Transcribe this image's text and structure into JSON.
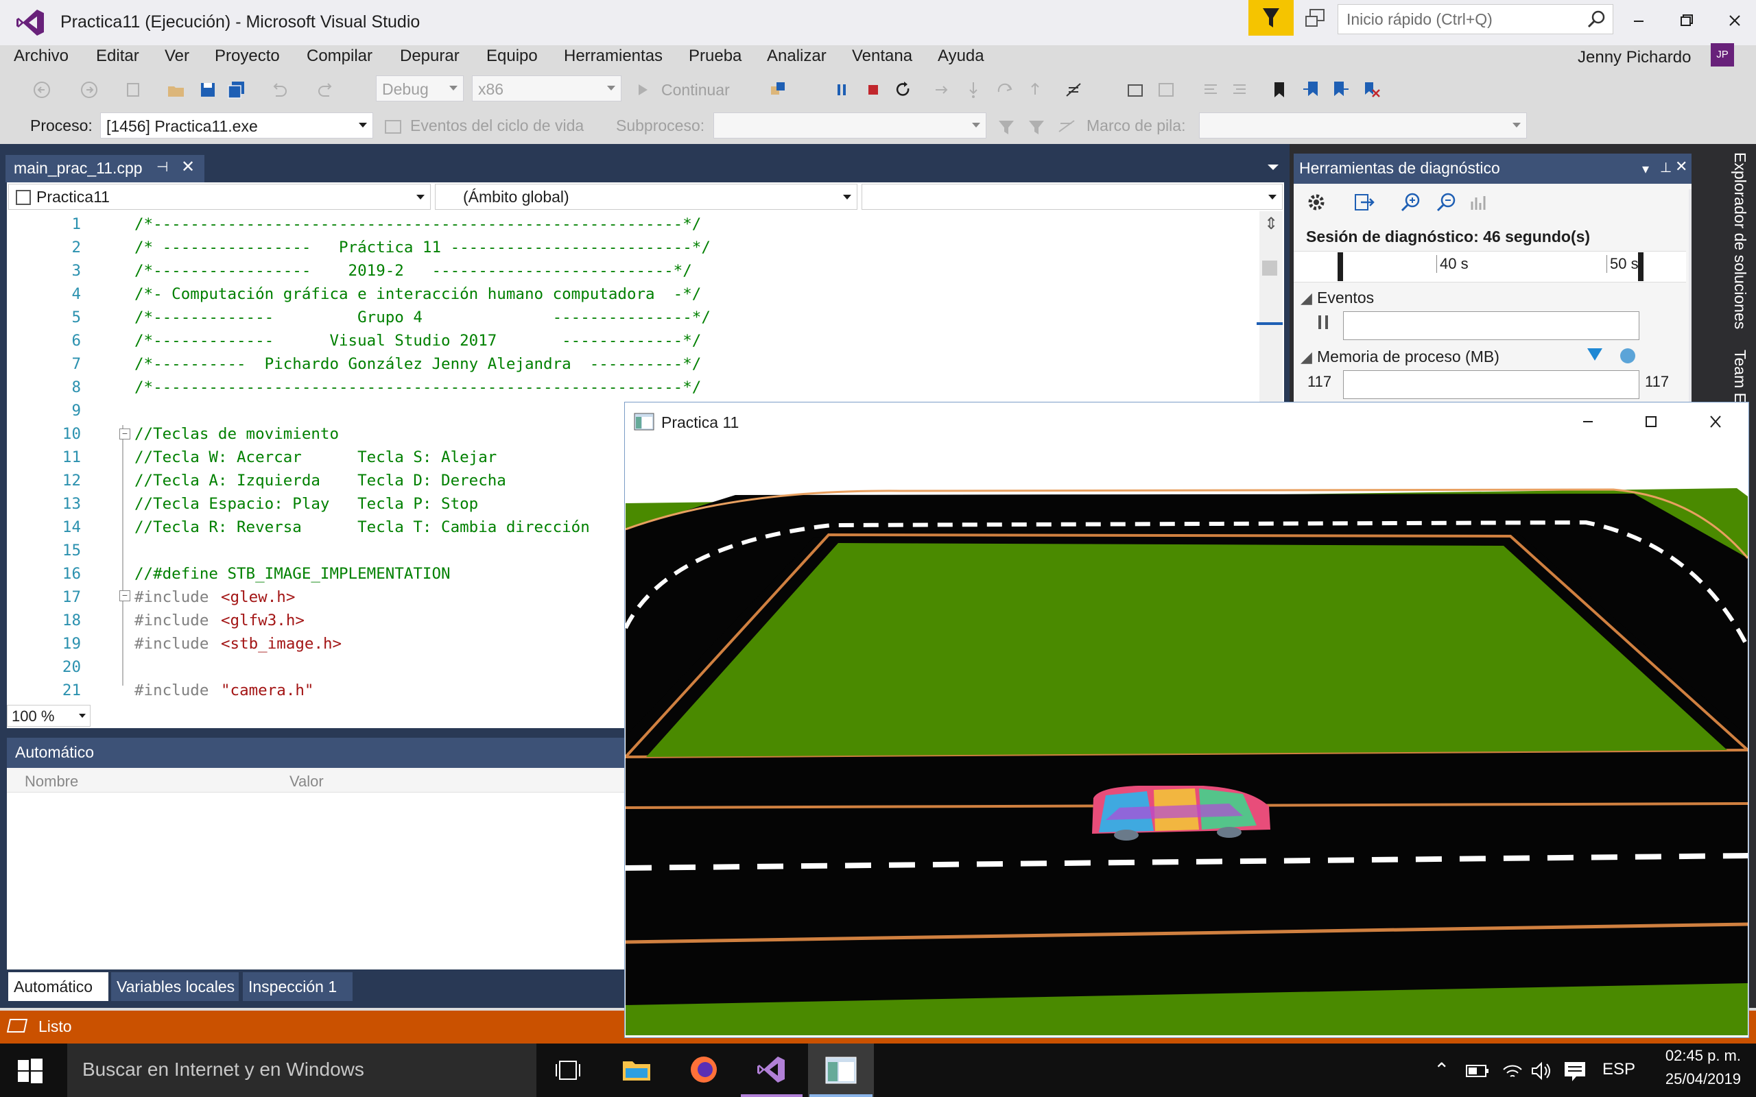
{
  "window": {
    "title": "Practica11 (Ejecución) - Microsoft Visual Studio",
    "quick_launch_placeholder": "Inicio rápido (Ctrl+Q)"
  },
  "menu": [
    "Archivo",
    "Editar",
    "Ver",
    "Proyecto",
    "Compilar",
    "Depurar",
    "Equipo",
    "Herramientas",
    "Prueba",
    "Analizar",
    "Ventana",
    "Ayuda"
  ],
  "user": {
    "name": "Jenny Pichardo",
    "initials": "JP"
  },
  "toolbar": {
    "config": "Debug",
    "platform": "x86",
    "continue": "Continuar",
    "process_label": "Proceso:",
    "process": "[1456] Practica11.exe",
    "lifecycle": "Eventos del ciclo de vida",
    "thread_label": "Subproceso:",
    "stack_label": "Marco de pila:"
  },
  "editor": {
    "tab": "main_prac_11.cpp",
    "scope_project": "Practica11",
    "scope_global": "(Ámbito global)",
    "zoom": "100 %",
    "lines": [
      {
        "n": "1",
        "t": "/*---------------------------------------------------------*/",
        "c": "cm"
      },
      {
        "n": "2",
        "t": "/* ----------------   Práctica 11 --------------------------*/",
        "c": "cm"
      },
      {
        "n": "3",
        "t": "/*-----------------    2019-2   --------------------------*/",
        "c": "cm"
      },
      {
        "n": "4",
        "t": "/*- Computación gráfica e interacción humano computadora  -*/",
        "c": "cm"
      },
      {
        "n": "5",
        "t": "/*-------------         Grupo 4              ---------------*/",
        "c": "cm"
      },
      {
        "n": "6",
        "t": "/*-------------      Visual Studio 2017       -------------*/",
        "c": "cm"
      },
      {
        "n": "7",
        "t": "/*----------  Pichardo González Jenny Alejandra  ----------*/",
        "c": "cm"
      },
      {
        "n": "8",
        "t": "/*---------------------------------------------------------*/",
        "c": "cm"
      },
      {
        "n": "9",
        "t": "",
        "c": "cm"
      },
      {
        "n": "10",
        "t": "//Teclas de movimiento",
        "c": "cm"
      },
      {
        "n": "11",
        "t": "//Tecla W: Acercar      Tecla S: Alejar",
        "c": "cm"
      },
      {
        "n": "12",
        "t": "//Tecla A: Izquierda    Tecla D: Derecha",
        "c": "cm"
      },
      {
        "n": "13",
        "t": "//Tecla Espacio: Play   Tecla P: Stop",
        "c": "cm"
      },
      {
        "n": "14",
        "t": "//Tecla R: Reversa      Tecla T: Cambia dirección",
        "c": "cm"
      },
      {
        "n": "15",
        "t": "",
        "c": "cm"
      },
      {
        "n": "16",
        "t": "//#define STB_IMAGE_IMPLEMENTATION",
        "c": "cm"
      },
      {
        "n": "17",
        "t": "#include",
        "c": "pp",
        "s": "<glew.h>"
      },
      {
        "n": "18",
        "t": "#include",
        "c": "pp",
        "s": "<glfw3.h>"
      },
      {
        "n": "19",
        "t": "#include",
        "c": "pp",
        "s": "<stb_image.h>"
      },
      {
        "n": "20",
        "t": "",
        "c": "cm"
      },
      {
        "n": "21",
        "t": "#include",
        "c": "pp",
        "s": "\"camera.h\""
      }
    ]
  },
  "auto_panel": {
    "title": "Automático",
    "col_name": "Nombre",
    "col_value": "Valor",
    "tabs": [
      "Automático",
      "Variables locales",
      "Inspección 1"
    ]
  },
  "diagnostics": {
    "title": "Herramientas de diagnóstico",
    "session": "Sesión de diagnóstico: 46 segundo(s)",
    "tick1": "40 s",
    "tick2": "50 s",
    "events": "Eventos",
    "memory": "Memoria de proceso (MB)",
    "mem_left": "117",
    "mem_right": "117"
  },
  "side_tabs": [
    "Explorador de soluciones",
    "Team E"
  ],
  "status": "Listo",
  "game": {
    "title": "Practica 11"
  },
  "taskbar": {
    "search": "Buscar en Internet y en Windows",
    "lang": "ESP",
    "time": "02:45 p. m.",
    "date": "25/04/2019"
  },
  "colors": {
    "accent": "#68217a",
    "status": "#ca5100",
    "filter": "#f5c400"
  }
}
